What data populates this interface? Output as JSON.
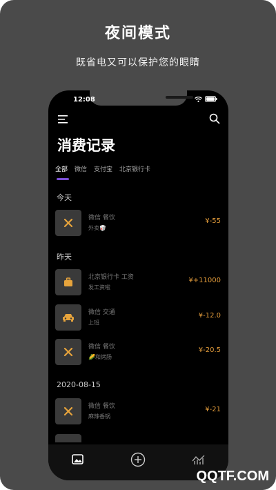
{
  "promo": {
    "headline": "夜间模式",
    "subline": "既省电又可以保护您的眼睛"
  },
  "status_bar": {
    "time": "12:08"
  },
  "header": {
    "title": "消费记录"
  },
  "tabs": [
    {
      "label": "全部",
      "active": true
    },
    {
      "label": "微信",
      "active": false
    },
    {
      "label": "支付宝",
      "active": false
    },
    {
      "label": "北京银行卡",
      "active": false
    }
  ],
  "sections": [
    {
      "label": "今天"
    },
    {
      "label": "昨天"
    },
    {
      "label": "2020-08-15"
    }
  ],
  "transactions": [
    {
      "category": "微信 餐饮",
      "note": "外卖🥡",
      "amount": "¥-55",
      "icon": "fork-knife-icon"
    },
    {
      "category": "北京银行卡 工资",
      "note": "发工资啦",
      "amount": "¥+11000",
      "icon": "briefcase-icon"
    },
    {
      "category": "微信 交通",
      "note": "上班",
      "amount": "¥-12.0",
      "icon": "car-icon"
    },
    {
      "category": "微信 餐饮",
      "note": "🌽和烤肠",
      "amount": "¥-20.5",
      "icon": "fork-knife-icon"
    },
    {
      "category": "微信 餐饮",
      "note": "麻辣香锅",
      "amount": "¥-21",
      "icon": "fork-knife-icon"
    }
  ],
  "colors": {
    "accent": "#7b4fd6",
    "amount": "#e39c3b",
    "icon": "#e7a43c"
  },
  "watermark": "QQTF.COM"
}
